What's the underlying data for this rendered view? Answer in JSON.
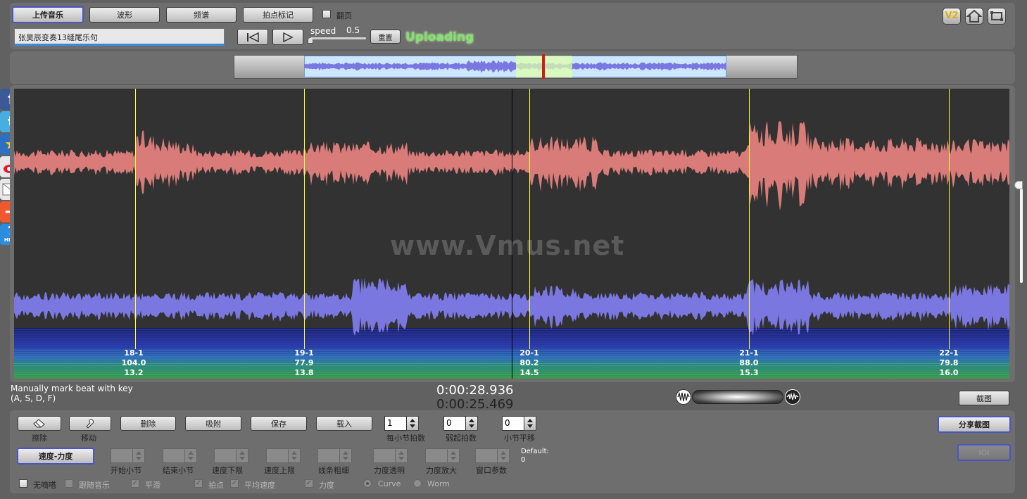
{
  "toolbar": {
    "upload_label": "上传音乐",
    "waveform_label": "波形",
    "spectrum_label": "频谱",
    "beat_mark_label": "拍点标记",
    "page_flip_label": "翻页",
    "song_title": "张昊辰变奏13缝尾乐句",
    "speed_label": "speed",
    "speed_value": "0.5",
    "reset_label": "重置",
    "status_text": "Uploading",
    "v2_label": "V2"
  },
  "main": {
    "watermark": "www.Vmus.net",
    "markers": [
      {
        "bar": "18-1",
        "tempo": "104.0",
        "dyn": "13.2"
      },
      {
        "bar": "19-1",
        "tempo": "77.9",
        "dyn": "13.8"
      },
      {
        "bar": "20-1",
        "tempo": "80.2",
        "dyn": "14.5"
      },
      {
        "bar": "21-1",
        "tempo": "88.0",
        "dyn": "15.3"
      },
      {
        "bar": "22-1",
        "tempo": "79.8",
        "dyn": "16.0"
      }
    ]
  },
  "status": {
    "hint_line1": "Manually mark beat with key",
    "hint_line2": "(A, S, D, F)",
    "time_current": "0:00:28.936",
    "time_total": "0:00:25.469",
    "screenshot_label": "截图"
  },
  "controls": {
    "erase_label": "擦除",
    "move_label": "移动",
    "delete_label": "删除",
    "snap_label": "吸附",
    "save_label": "保存",
    "load_label": "载入",
    "beats_per_bar": "1",
    "beats_per_bar_label": "每小节拍数",
    "pickup_beats": "0",
    "pickup_label": "弱起拍数",
    "bar_shift": "0",
    "bar_shift_label": "小节平移",
    "share_label": "分享截图",
    "ioi_label": "IOI",
    "tempo_dyn_label": "速度-力度",
    "start_bar_label": "开始小节",
    "end_bar_label": "结束小节",
    "tempo_low_label": "速度下限",
    "tempo_high_label": "速度上限",
    "line_width_label": "线条粗细",
    "dyn_alpha_label": "力度透明",
    "dyn_zoom_label": "力度放大",
    "window_param_label": "窗口参数",
    "default_label": "Default:",
    "default_value": "0",
    "no_click_label": "无嘀嗒",
    "follow_music_label": "跟随音乐",
    "smooth_label": "平滑",
    "beat_point_label": "拍点",
    "avg_tempo_label": "平均速度",
    "dynamics_label": "力度",
    "curve_label": "Curve",
    "worm_label": "Worm"
  },
  "colors": {
    "accent_blue": "#4a55c8",
    "status_green": "#7de36a",
    "wave_red": "#d97b78",
    "wave_blue": "#7a78e0",
    "marker_yellow": "#ffff33"
  }
}
